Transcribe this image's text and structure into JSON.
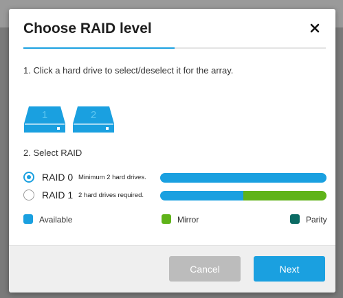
{
  "dialog": {
    "title": "Choose RAID level",
    "step_progress": 0.5
  },
  "step1": {
    "instruction": "1. Click a hard drive to select/deselect it for the array."
  },
  "drives": [
    {
      "number": "1",
      "selected": true
    },
    {
      "number": "2",
      "selected": true
    }
  ],
  "step2": {
    "label": "2. Select RAID"
  },
  "raid_options": [
    {
      "name": "RAID 0",
      "requirement": "Minimum 2 hard drives.",
      "selected": true,
      "capacity": {
        "available": 1.0,
        "mirror": 0.0,
        "parity": 0.0
      }
    },
    {
      "name": "RAID 1",
      "requirement": "2 hard drives required.",
      "selected": false,
      "capacity": {
        "available": 0.5,
        "mirror": 0.5,
        "parity": 0.0
      }
    }
  ],
  "legend": {
    "available": "Available",
    "mirror": "Mirror",
    "parity": "Parity"
  },
  "colors": {
    "accent": "#1aa0e0",
    "available": "#1aa0e0",
    "mirror": "#5fb319",
    "parity": "#0b6b64",
    "drive": "#1aa0e0"
  },
  "icons": {
    "close": "close-icon",
    "drive": "hard-drive-icon"
  },
  "footer": {
    "cancel_label": "Cancel",
    "next_label": "Next"
  }
}
